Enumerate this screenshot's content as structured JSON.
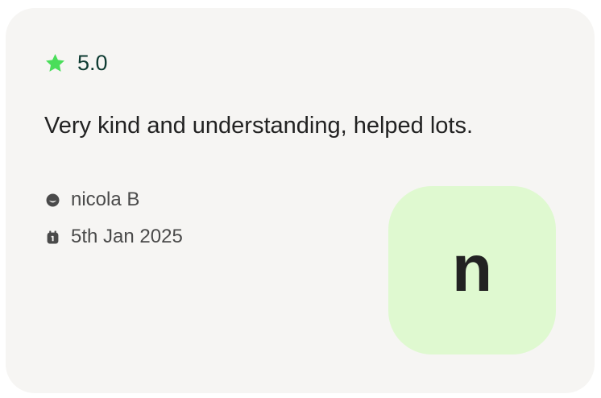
{
  "review": {
    "rating": "5.0",
    "rating_icon": "star-icon",
    "text": "Very kind and understanding, helped lots.",
    "author": "nicola B",
    "author_icon": "user-face-icon",
    "date": "5th Jan 2025",
    "date_icon": "calendar-icon",
    "avatar_initial": "n"
  },
  "colors": {
    "card_background": "#f6f5f3",
    "star": "#4ade5a",
    "rating_text": "#0e3b32",
    "avatar_background": "#dff9d0"
  }
}
